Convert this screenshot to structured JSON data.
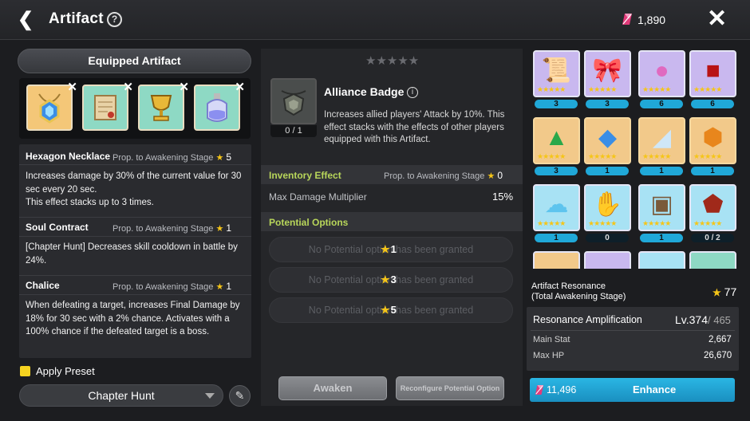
{
  "header": {
    "title": "Artifact",
    "help": "?",
    "currency": "1,890"
  },
  "left": {
    "equipped_label": "Equipped Artifact",
    "desc": [
      {
        "name": "Hexagon Necklace",
        "prop": "Prop. to Awakening Stage",
        "star_val": "5",
        "text": "Increases damage by 30% of the current value for 30 sec every 20 sec.\nThis effect stacks up to 3 times."
      },
      {
        "name": "Soul Contract",
        "prop": "Prop. to Awakening Stage",
        "star_val": "1",
        "text": "[Chapter Hunt] Decreases skill cooldown in battle by 24%."
      },
      {
        "name": "Chalice",
        "prop": "Prop. to Awakening Stage",
        "star_val": "1",
        "text": "When defeating a target, increases Final Damage by 18% for 30 sec with a 2% chance. Activates with a 100% chance if the defeated target is a boss."
      }
    ],
    "apply_preset": "Apply Preset",
    "preset_select": "Chapter Hunt"
  },
  "middle": {
    "badge_count": "0 / 1",
    "badge_name": "Alliance Badge",
    "badge_desc": "Increases allied players' Attack by 10%. This effect stacks with the effects of other players equipped with this Artifact.",
    "inventory_label": "Inventory Effect",
    "inventory_prop": "Prop. to Awakening Stage",
    "inventory_star_val": "0",
    "max_dmg_label": "Max Damage Multiplier",
    "max_dmg_value": "15%",
    "potential_label": "Potential Options",
    "potentials": [
      {
        "text": "No Potential option has been granted",
        "stars": "1"
      },
      {
        "text": "No Potential option has been granted",
        "stars": "3"
      },
      {
        "text": "No Potential option has been granted",
        "stars": "5"
      }
    ],
    "awaken_label": "Awaken",
    "reconfigure_label": "Reconfigure Potential Option"
  },
  "right": {
    "artifacts": [
      {
        "name": "scroll-gold",
        "level": "3",
        "bg": "#c9b8ef"
      },
      {
        "name": "red-ribbon",
        "level": "3",
        "bg": "#c9b8ef"
      },
      {
        "name": "pink-orb",
        "level": "6",
        "bg": "#c9b8ef"
      },
      {
        "name": "red-box",
        "level": "6",
        "bg": "#c9b8ef"
      },
      {
        "name": "rainbow-leaf",
        "level": "3",
        "bg": "#f2c98a"
      },
      {
        "name": "blue-mirror",
        "level": "1",
        "bg": "#f2c98a"
      },
      {
        "name": "glass-slipper",
        "level": "1",
        "bg": "#f2c98a"
      },
      {
        "name": "amber-stone",
        "level": "1",
        "bg": "#f2c98a"
      },
      {
        "name": "ice-cloud",
        "level": "1",
        "bg": "#a8e2f4"
      },
      {
        "name": "brown-glove",
        "level": "0",
        "bg": "#a8e2f4"
      },
      {
        "name": "lantern",
        "level": "1",
        "bg": "#a8e2f4"
      },
      {
        "name": "lava-rock",
        "level": "0 / 2",
        "bg": "#a8e2f4"
      }
    ],
    "resonance_label_1": "Artifact Resonance",
    "resonance_label_2": "(Total Awakening Stage)",
    "resonance_value": "77",
    "amp_label": "Resonance Amplification",
    "amp_level": "Lv.374",
    "amp_max": "/ 465",
    "main_stat_label": "Main Stat",
    "main_stat_value": "2,667",
    "max_hp_label": "Max HP",
    "max_hp_value": "26,670",
    "enhance_cost": "11,496",
    "enhance_label": "Enhance"
  }
}
